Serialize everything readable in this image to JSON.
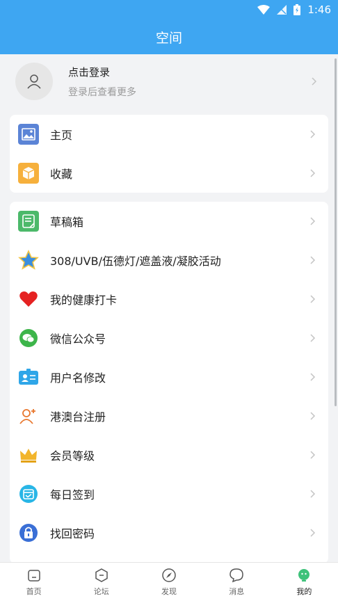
{
  "status": {
    "time": "1:46"
  },
  "header": {
    "title": "空间"
  },
  "login": {
    "title": "点击登录",
    "subtitle": "登录后查看更多"
  },
  "group1": [
    {
      "label": "主页",
      "icon": "picture-icon"
    },
    {
      "label": "收藏",
      "icon": "box-icon"
    }
  ],
  "group2": [
    {
      "label": "草稿箱",
      "icon": "note-icon"
    },
    {
      "label": "308/UVB/伍德灯/遮盖液/凝胶活动",
      "icon": "star-icon"
    },
    {
      "label": "我的健康打卡",
      "icon": "heart-icon"
    },
    {
      "label": "微信公众号",
      "icon": "wechat-icon"
    },
    {
      "label": "用户名修改",
      "icon": "id-card-icon"
    },
    {
      "label": "港澳台注册",
      "icon": "add-user-icon"
    },
    {
      "label": "会员等级",
      "icon": "crown-icon"
    },
    {
      "label": "每日签到",
      "icon": "calendar-icon"
    },
    {
      "label": "找回密码",
      "icon": "lock-icon"
    }
  ],
  "tabs": [
    {
      "label": "首页",
      "icon": "home-icon"
    },
    {
      "label": "论坛",
      "icon": "forum-icon"
    },
    {
      "label": "发现",
      "icon": "compass-icon"
    },
    {
      "label": "消息",
      "icon": "message-icon"
    },
    {
      "label": "我的",
      "icon": "profile-icon",
      "active": true
    }
  ],
  "colors": {
    "accent": "#3ea6f2",
    "background": "#f2f3f5"
  }
}
